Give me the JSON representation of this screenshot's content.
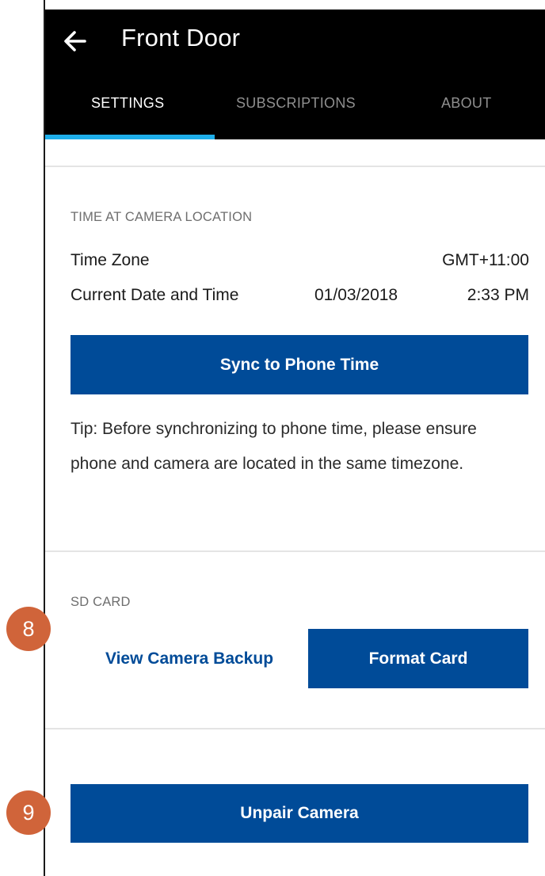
{
  "header": {
    "title": "Front Door",
    "back_icon": "arrow-left-icon"
  },
  "tabs": [
    {
      "label": "SETTINGS",
      "active": true
    },
    {
      "label": "SUBSCRIPTIONS",
      "active": false
    },
    {
      "label": "ABOUT",
      "active": false
    }
  ],
  "time_section": {
    "label": "TIME AT CAMERA LOCATION",
    "time_zone_label": "Time Zone",
    "time_zone_value": "GMT+11:00",
    "datetime_label": "Current Date and Time",
    "date_value": "01/03/2018",
    "time_value": "2:33 PM",
    "sync_button": "Sync to Phone Time",
    "tip": "Tip: Before synchronizing to phone time, please ensure phone and camera are located in the same timezone."
  },
  "sd_section": {
    "label": "SD CARD",
    "view_backup_button": "View Camera Backup",
    "format_button": "Format Card"
  },
  "unpair_button": "Unpair Camera",
  "callouts": [
    "8",
    "9"
  ],
  "colors": {
    "header_bg": "#000000",
    "tab_indicator": "#1eaeea",
    "primary": "#004b98",
    "callout": "#d0643a"
  }
}
